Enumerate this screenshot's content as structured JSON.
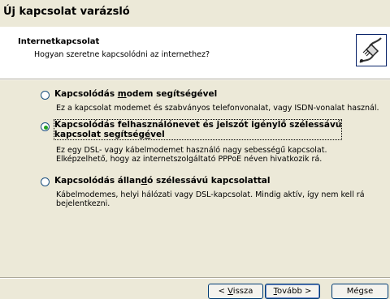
{
  "window": {
    "title": "Új kapcsolat varázsló"
  },
  "header": {
    "title": "Internetkapcsolat",
    "subtitle": "Hogyan szeretne kapcsolódni az internethez?",
    "icon": "network-cable-icon"
  },
  "options": [
    {
      "label_before": "Kapcsolódás ",
      "label_hotkey": "m",
      "label_after": "odem segítségével",
      "desc1": "Ez a kapcsolat modemet és szabványos telefonvonalat, vagy ISDN-vonalat használ.",
      "desc2": "",
      "selected": false
    },
    {
      "label1": "Kapcsolódás felhasználónevet és jelszót igénylő szélessávú",
      "label2_before": "kapcsolat segítség",
      "label2_hotkey": "é",
      "label2_after": "vel",
      "desc1": "Ez egy DSL- vagy kábelmodemet használó nagy sebességű kapcsolat.",
      "desc2": "Elképzelhető, hogy az internetszolgáltató PPPoE néven hivatkozik rá.",
      "selected": true
    },
    {
      "label_before": "Kapcsolódás állan",
      "label_hotkey": "d",
      "label_after": "ó szélessávú kapcsolattal",
      "desc1": "Kábelmodemes, helyi hálózati vagy DSL-kapcsolat. Mindig aktív, így nem kell rá",
      "desc2": "bejelentkezni.",
      "selected": false
    }
  ],
  "buttons": {
    "back_prefix": "< ",
    "back_hotkey": "V",
    "back_rest": "issza",
    "next_hotkey": "T",
    "next_rest": "ovább >",
    "cancel": "Mégse"
  }
}
